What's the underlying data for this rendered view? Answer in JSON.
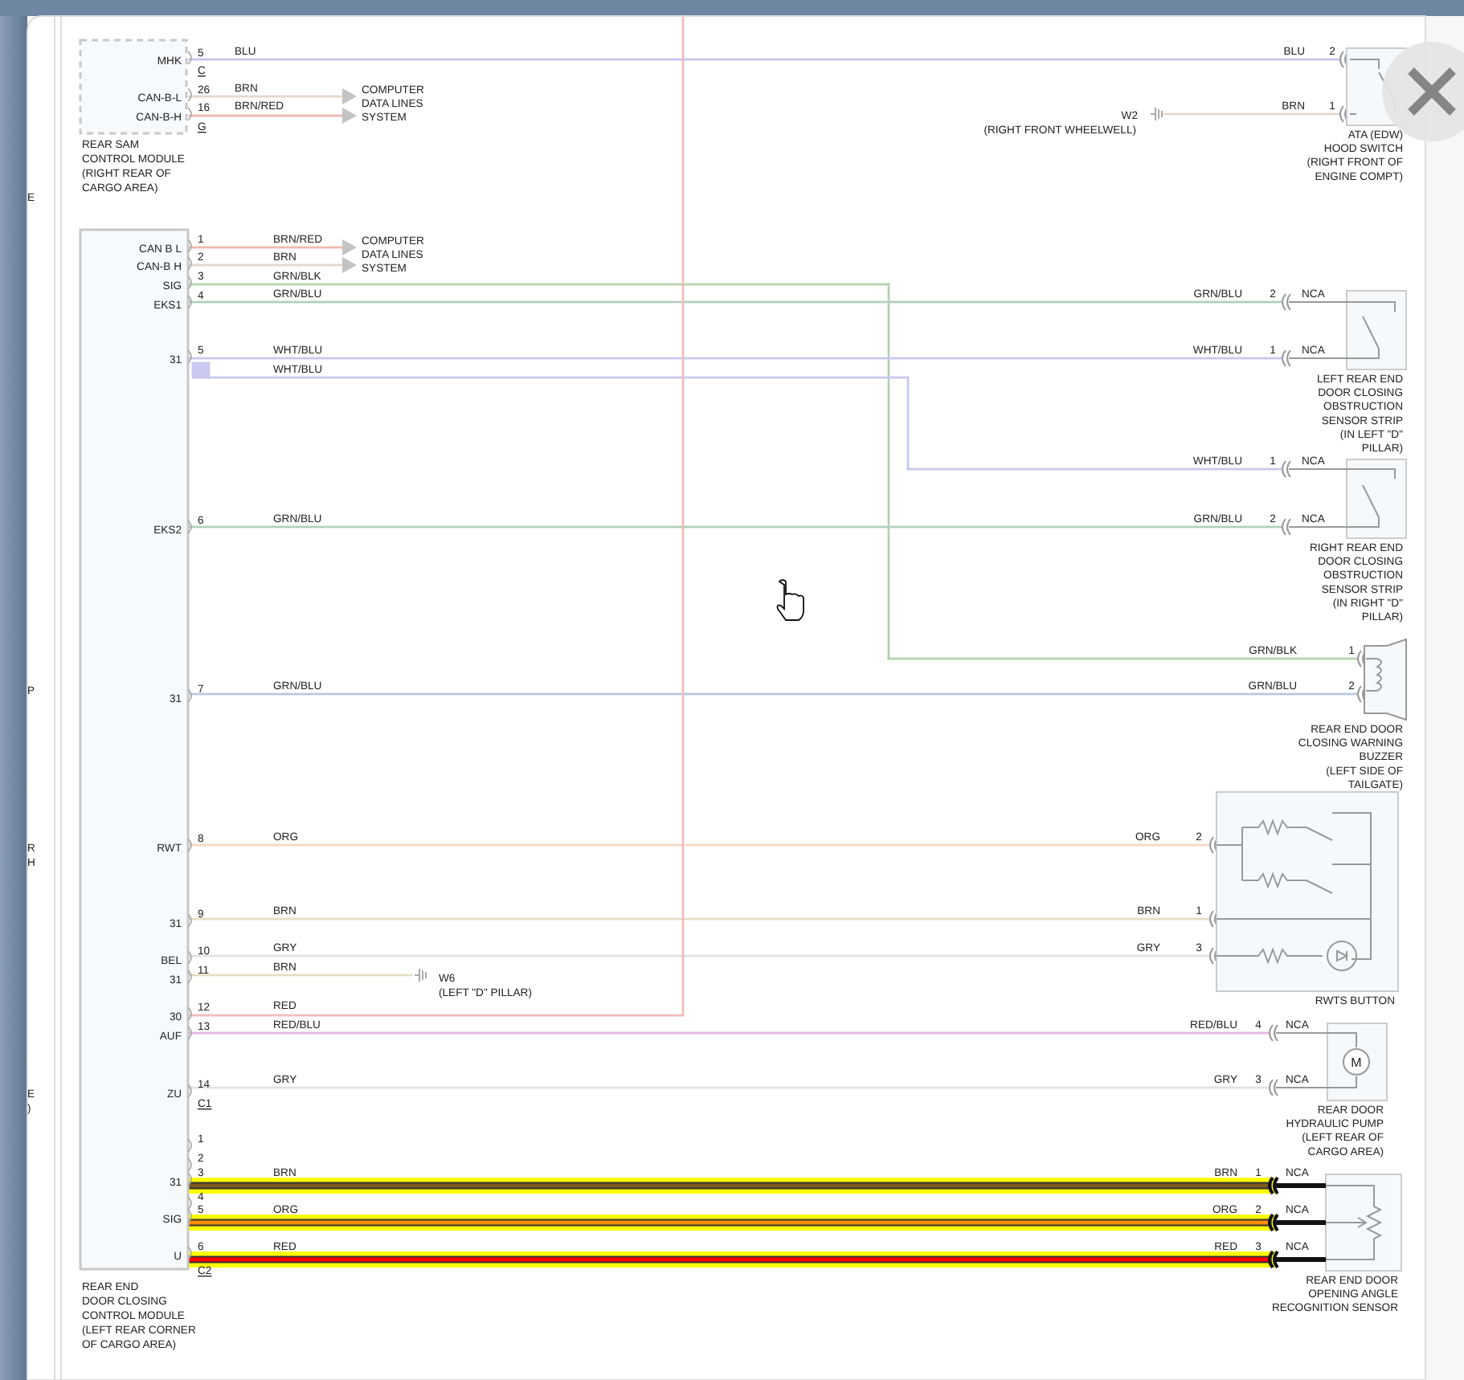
{
  "background_window": {
    "texts": [
      "E",
      "P",
      "R",
      "H",
      "E",
      ")"
    ]
  },
  "modules": [
    {
      "name_lines": [
        "REAR SAM",
        "CONTROL MODULE",
        "(RIGHT REAR OF",
        "CARGO AREA)"
      ],
      "pins": [
        {
          "kind": "pin",
          "number": "5",
          "signal": "MHK"
        },
        {
          "kind": "connector",
          "label": "C"
        },
        {
          "kind": "pin",
          "number": "26",
          "signal": "CAN-B-L"
        },
        {
          "kind": "pin",
          "number": "16",
          "signal": "CAN-B-H"
        },
        {
          "kind": "connector",
          "label": "G"
        }
      ]
    },
    {
      "name_lines": [
        "REAR END",
        "DOOR CLOSING",
        "CONTROL MODULE",
        "(LEFT REAR CORNER",
        "OF CARGO AREA)"
      ],
      "pins": [
        {
          "kind": "pin",
          "number": "1",
          "signal": "CAN B L"
        },
        {
          "kind": "pin",
          "number": "2",
          "signal": "CAN-B H"
        },
        {
          "kind": "pin",
          "number": "3",
          "signal": "SIG"
        },
        {
          "kind": "pin",
          "number": "4",
          "signal": "EKS1"
        },
        {
          "kind": "pin",
          "number": "5",
          "signal": "31"
        },
        {
          "kind": "pin",
          "number": "6",
          "signal": "EKS2"
        },
        {
          "kind": "pin",
          "number": "7",
          "signal": "31"
        },
        {
          "kind": "pin",
          "number": "8",
          "signal": "RWT"
        },
        {
          "kind": "pin",
          "number": "9",
          "signal": "31"
        },
        {
          "kind": "pin",
          "number": "10",
          "signal": "BEL"
        },
        {
          "kind": "pin",
          "number": "11",
          "signal": "31"
        },
        {
          "kind": "pin",
          "number": "12",
          "signal": "30"
        },
        {
          "kind": "pin",
          "number": "13",
          "signal": "AUF"
        },
        {
          "kind": "pin",
          "number": "14",
          "signal": "ZU"
        },
        {
          "kind": "connector",
          "label": "C1"
        },
        {
          "kind": "pin",
          "number": "1"
        },
        {
          "kind": "pin",
          "number": "2"
        },
        {
          "kind": "pin",
          "number": "3",
          "signal": "31"
        },
        {
          "kind": "pin",
          "number": "4"
        },
        {
          "kind": "pin",
          "number": "5",
          "signal": "SIG"
        },
        {
          "kind": "pin",
          "number": "6",
          "signal": "U"
        },
        {
          "kind": "connector",
          "label": "C2"
        }
      ]
    }
  ],
  "wires": [
    {
      "kind": "line",
      "label": "BLU",
      "color": "#c4c4f2",
      "highlighted": false
    },
    {
      "kind": "arrow",
      "label": "BRN",
      "color": "#e4d8cc",
      "highlighted": false
    },
    {
      "kind": "arrow",
      "label": "BRN/RED",
      "color": "#f2b8ae",
      "highlighted": false
    },
    {
      "kind": "line",
      "color": "#e4d8cc",
      "highlighted": false
    },
    {
      "kind": "arrow",
      "label": "BRN/RED",
      "color": "#f2b8ae",
      "highlighted": false
    },
    {
      "kind": "arrow",
      "label": "BRN",
      "color": "#e4d8cc",
      "highlighted": false
    },
    {
      "kind": "line",
      "label": "GRN/BLK",
      "color": "#b4d4ac",
      "highlighted": false
    },
    {
      "kind": "line",
      "label": "GRN/BLU",
      "color": "#b2d0bc",
      "highlighted": false
    },
    {
      "kind": "line",
      "label": "WHT/BLU",
      "color": "#c8c8f0",
      "highlighted": false
    },
    {
      "kind": "line",
      "label": "WHT/BLU",
      "color": "#c8c8f0",
      "highlighted": false
    },
    {
      "kind": "line",
      "label": "GRN/BLU",
      "color": "#b2d0bc",
      "highlighted": false
    },
    {
      "kind": "line",
      "label": "GRN/BLU",
      "color": "#b8c8e0",
      "highlighted": false
    },
    {
      "kind": "line",
      "label": "ORG",
      "color": "#f6d8c0",
      "highlighted": false
    },
    {
      "kind": "line",
      "label": "BRN",
      "color": "#e6dcc6",
      "highlighted": false
    },
    {
      "kind": "line",
      "label": "GRY",
      "color": "#e2e2e2",
      "highlighted": false
    },
    {
      "kind": "line",
      "label": "BRN",
      "color": "#e6dcc6",
      "highlighted": false
    },
    {
      "kind": "line",
      "label": "RED",
      "color": "#f2bcbc",
      "highlighted": false
    },
    {
      "kind": "line",
      "label": "RED/BLU",
      "color": "#e6b4dc",
      "highlighted": false
    },
    {
      "kind": "line",
      "label": "GRY",
      "color": "#e2e2e2",
      "highlighted": false
    },
    {
      "kind": "line",
      "label": "BRN",
      "color": "#7a5a20",
      "highlighted": true
    },
    {
      "kind": "line",
      "label": "ORG",
      "color": "#ff8c00",
      "highlighted": true
    },
    {
      "kind": "line",
      "label": "RED",
      "color": "#ff0000",
      "highlighted": true
    }
  ],
  "data_lines": [
    {
      "lines": [
        "COMPUTER",
        "DATA LINES",
        "SYSTEM"
      ]
    },
    {
      "lines": [
        "COMPUTER",
        "DATA LINES",
        "SYSTEM"
      ]
    }
  ],
  "grounds": [
    {
      "name": "W2",
      "location": "(RIGHT FRONT WHEELWELL)"
    },
    {
      "name": "W6",
      "location": "(LEFT \"D\" PILLAR)"
    }
  ],
  "components": [
    {
      "kind": "switch",
      "name_lines": [
        "ATA (EDW)",
        "HOOD SWITCH",
        "(RIGHT FRONT OF",
        "ENGINE COMPT)"
      ],
      "pins": [
        {
          "wire_label": "BLU",
          "number": "2",
          "highlighted": false
        },
        {
          "wire_label": "BRN",
          "number": "1",
          "highlighted": false
        }
      ]
    },
    {
      "kind": "strip",
      "name_lines": [
        "LEFT REAR END",
        "DOOR CLOSING",
        "OBSTRUCTION",
        "SENSOR STRIP",
        "(IN LEFT \"D\"",
        "PILLAR)"
      ],
      "pins": [
        {
          "wire_label": "GRN/BLU",
          "number": "2",
          "nca": "NCA",
          "highlighted": false
        },
        {
          "wire_label": "WHT/BLU",
          "number": "1",
          "nca": "NCA",
          "highlighted": false
        }
      ]
    },
    {
      "kind": "strip",
      "name_lines": [
        "RIGHT REAR END",
        "DOOR CLOSING",
        "OBSTRUCTION",
        "SENSOR STRIP",
        "(IN RIGHT \"D\"",
        "PILLAR)"
      ],
      "pins": [
        {
          "wire_label": "WHT/BLU",
          "number": "1",
          "nca": "NCA",
          "highlighted": false
        },
        {
          "wire_label": "GRN/BLU",
          "number": "2",
          "nca": "NCA",
          "highlighted": false
        }
      ]
    },
    {
      "kind": "buzzer",
      "name_lines": [
        "REAR END DOOR",
        "CLOSING WARNING",
        "BUZZER",
        "(LEFT SIDE OF",
        "TAILGATE)"
      ],
      "pins": [
        {
          "wire_label": "GRN/BLK",
          "number": "1",
          "highlighted": false
        },
        {
          "wire_label": "GRN/BLU",
          "number": "2",
          "highlighted": false
        }
      ]
    },
    {
      "kind": "button",
      "name_lines": [
        "RWTS BUTTON"
      ],
      "pins": [
        {
          "wire_label": "ORG",
          "number": "2",
          "highlighted": false
        },
        {
          "wire_label": "BRN",
          "number": "1",
          "highlighted": false
        },
        {
          "wire_label": "GRY",
          "number": "3",
          "highlighted": false
        }
      ]
    },
    {
      "kind": "pump",
      "symbol": "M",
      "name_lines": [
        "REAR DOOR",
        "HYDRAULIC PUMP",
        "(LEFT REAR OF",
        "CARGO AREA)"
      ],
      "pins": [
        {
          "wire_label": "RED/BLU",
          "number": "4",
          "nca": "NCA",
          "highlighted": false
        },
        {
          "wire_label": "GRY",
          "number": "3",
          "nca": "NCA",
          "highlighted": false
        }
      ]
    },
    {
      "kind": "potentiometer",
      "name_lines": [
        "REAR END DOOR",
        "OPENING ANGLE",
        "RECOGNITION SENSOR"
      ],
      "pins": [
        {
          "wire_label": "BRN",
          "number": "1",
          "nca": "NCA",
          "highlighted": true
        },
        {
          "wire_label": "ORG",
          "number": "2",
          "nca": "NCA",
          "highlighted": true
        },
        {
          "wire_label": "RED",
          "number": "3",
          "nca": "NCA",
          "highlighted": true
        }
      ]
    }
  ]
}
